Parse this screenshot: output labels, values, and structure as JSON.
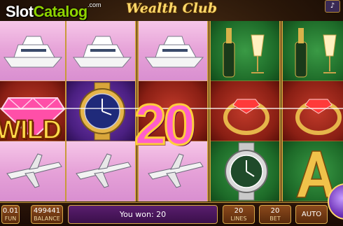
{
  "watermark": {
    "brand_a": "Slot",
    "brand_b": "Catalog",
    "suffix": ".com"
  },
  "title": "Wealth Club",
  "sound_icon": "speaker-icon",
  "reels": [
    {
      "symbols": [
        "yacht",
        "wild-diamond",
        "jet"
      ]
    },
    {
      "symbols": [
        "yacht",
        "watch",
        "jet"
      ]
    },
    {
      "symbols": [
        "yacht",
        "multiplier-20",
        "jet"
      ]
    },
    {
      "symbols": [
        "champagne",
        "ring",
        "watch"
      ]
    },
    {
      "symbols": [
        "champagne",
        "ring",
        "ace"
      ]
    }
  ],
  "wild_label": "WILD",
  "multiplier_label": "20",
  "bottom": {
    "coin_value": "0.01",
    "coin_label": "FUN",
    "balance_value": "499441",
    "balance_label": "BALANCE",
    "message": "You won: 20",
    "lines_value": "20",
    "lines_label": "LINES",
    "bet_value": "20",
    "bet_label": "BET",
    "auto_label": "AUTO"
  }
}
